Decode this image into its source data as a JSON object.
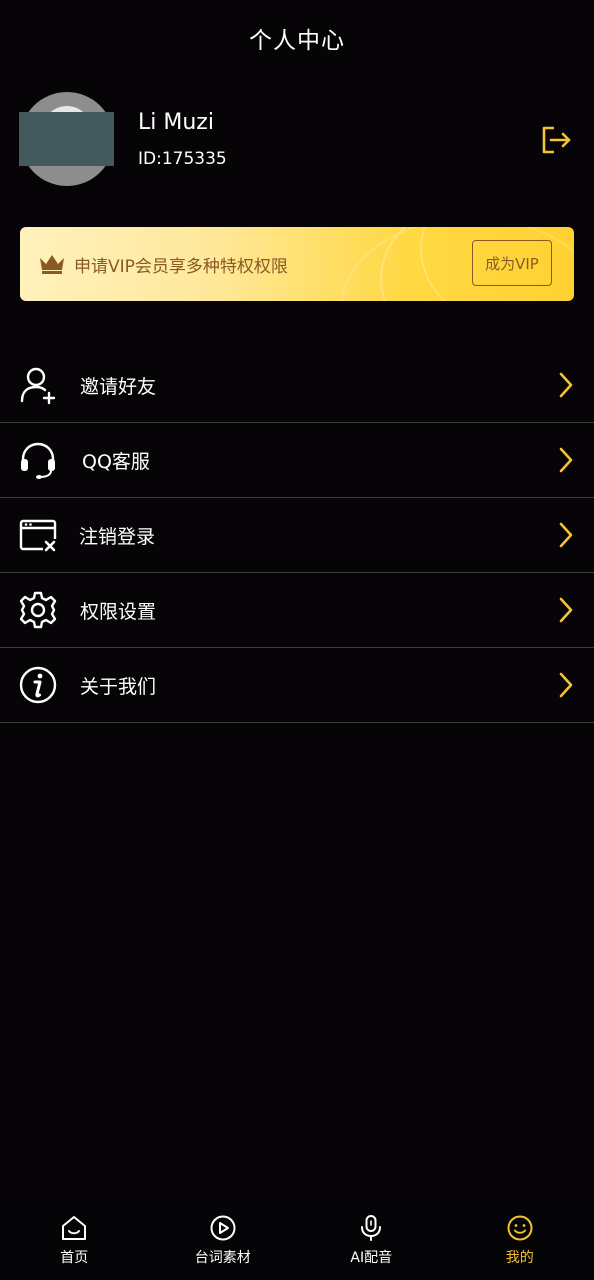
{
  "header": {
    "title": "个人中心"
  },
  "profile": {
    "name": "Li Muzi",
    "id_text": "ID:175335",
    "logout_icon": "logout-icon"
  },
  "vip": {
    "text": "申请VIP会员享多种特权权限",
    "button_label": "成为VIP",
    "crown_icon": "crown-icon"
  },
  "menu": {
    "items": [
      {
        "label": "邀请好友",
        "icon": "add-user-icon"
      },
      {
        "label": "QQ客服",
        "icon": "headset-icon"
      },
      {
        "label": "注销登录",
        "icon": "window-close-icon"
      },
      {
        "label": "权限设置",
        "icon": "gear-icon"
      },
      {
        "label": "关于我们",
        "icon": "info-icon"
      }
    ]
  },
  "tabbar": {
    "items": [
      {
        "label": "首页",
        "icon": "home-icon",
        "active": false
      },
      {
        "label": "台词素材",
        "icon": "play-circle-icon",
        "active": false
      },
      {
        "label": "AI配音",
        "icon": "microphone-icon",
        "active": false
      },
      {
        "label": "我的",
        "icon": "smiley-icon",
        "active": true
      }
    ]
  },
  "colors": {
    "background": "#070408",
    "accent": "#f5c331",
    "vip_text": "#8a5a25",
    "divider": "#3c3c3c"
  }
}
